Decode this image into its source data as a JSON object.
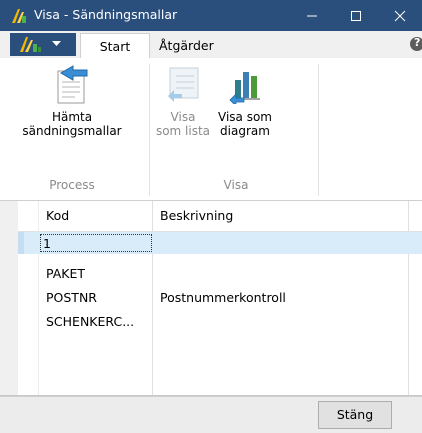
{
  "window": {
    "title": "Visa - Sändningsmallar",
    "title_color": "#2b4f7d"
  },
  "window_controls": {
    "minimize_icon": "minimize-icon",
    "maximize_icon": "maximize-icon",
    "close_icon": "close-icon"
  },
  "ribbon_tabs": {
    "start": "Start",
    "atgarder": "Åtgärder",
    "help_label": "?"
  },
  "ribbon": {
    "hamta": {
      "label_line1": "Hämta",
      "label_line2": "sändningsmallar",
      "icon": "fetch-document-icon"
    },
    "visa_lista": {
      "label_line1": "Visa",
      "label_line2": "som lista",
      "icon": "list-view-icon",
      "enabled": false
    },
    "visa_diagram": {
      "label_line1": "Visa som",
      "label_line2": "diagram",
      "icon": "chart-view-icon"
    },
    "groups": {
      "process": "Process",
      "visa": "Visa"
    }
  },
  "grid": {
    "columns": [
      "Kod",
      "Beskrivning"
    ],
    "rows": [
      {
        "kod": "1",
        "beskrivning": "",
        "selected": true
      },
      {
        "kod": "PAKET",
        "beskrivning": ""
      },
      {
        "kod": "POSTNR",
        "beskrivning": "Postnummerkontroll"
      },
      {
        "kod": "SCHENKERC...",
        "beskrivning": ""
      }
    ],
    "selection_color": "#d9ecf9"
  },
  "footer": {
    "close_label": "Stäng"
  }
}
